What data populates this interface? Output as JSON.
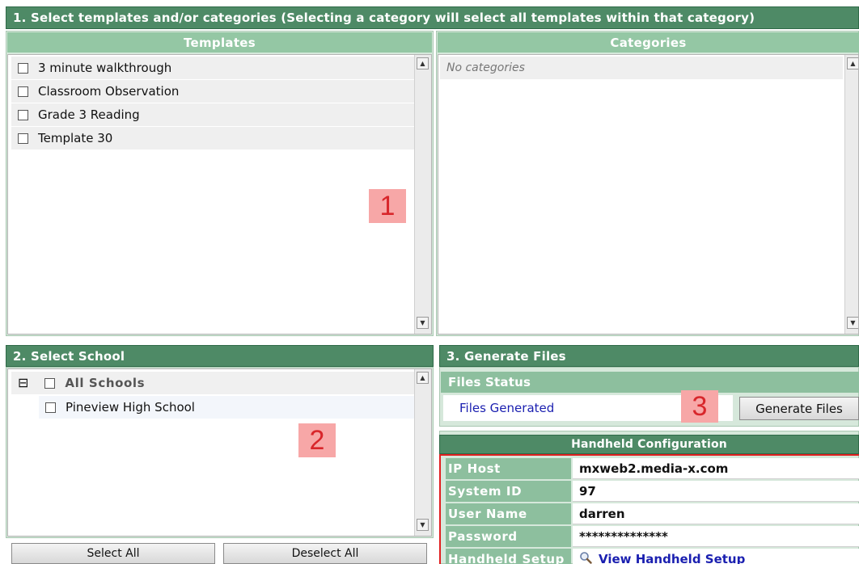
{
  "section1": {
    "title": "1. Select templates and/or categories (Selecting a category will select all templates within that category)",
    "templates_header": "Templates",
    "categories_header": "Categories",
    "templates": [
      {
        "label": "3 minute walkthrough",
        "checked": false
      },
      {
        "label": "Classroom Observation",
        "checked": false
      },
      {
        "label": "Grade 3 Reading",
        "checked": false
      },
      {
        "label": "Template 30",
        "checked": false
      }
    ],
    "categories_empty": "No categories",
    "annotation": "1"
  },
  "section2": {
    "title": "2. Select School",
    "tree_toggle": "⊟",
    "all_schools": "All Schools",
    "schools": [
      "Pineview High School"
    ],
    "select_all": "Select All",
    "deselect_all": "Deselect All",
    "annotation": "2"
  },
  "section3": {
    "title": "3. Generate Files",
    "files_status_header": "Files Status",
    "files_status_text": "Files Generated",
    "generate_button": "Generate Files",
    "annotation": "3"
  },
  "handheld": {
    "header": "Handheld Configuration",
    "rows": [
      {
        "label": "IP Host",
        "value": "mxweb2.media-x.com"
      },
      {
        "label": "System ID",
        "value": "97"
      },
      {
        "label": "User Name",
        "value": "darren"
      },
      {
        "label": "Password",
        "value": "**************"
      },
      {
        "label": "Handheld Setup",
        "value": "View Handheld Setup"
      }
    ]
  },
  "colors": {
    "header_dark": "#4e8a66",
    "header_light": "#94c7a4",
    "annotation_bg": "#f7a7a7",
    "annotation_text": "#d8262b",
    "link": "#1a1fb0",
    "config_border": "#e02020"
  },
  "icons": {
    "scroll_up": "scroll-up-arrow-icon",
    "scroll_down": "scroll-down-arrow-icon",
    "collapse": "tree-collapse-icon",
    "view": "magnifier-icon"
  }
}
